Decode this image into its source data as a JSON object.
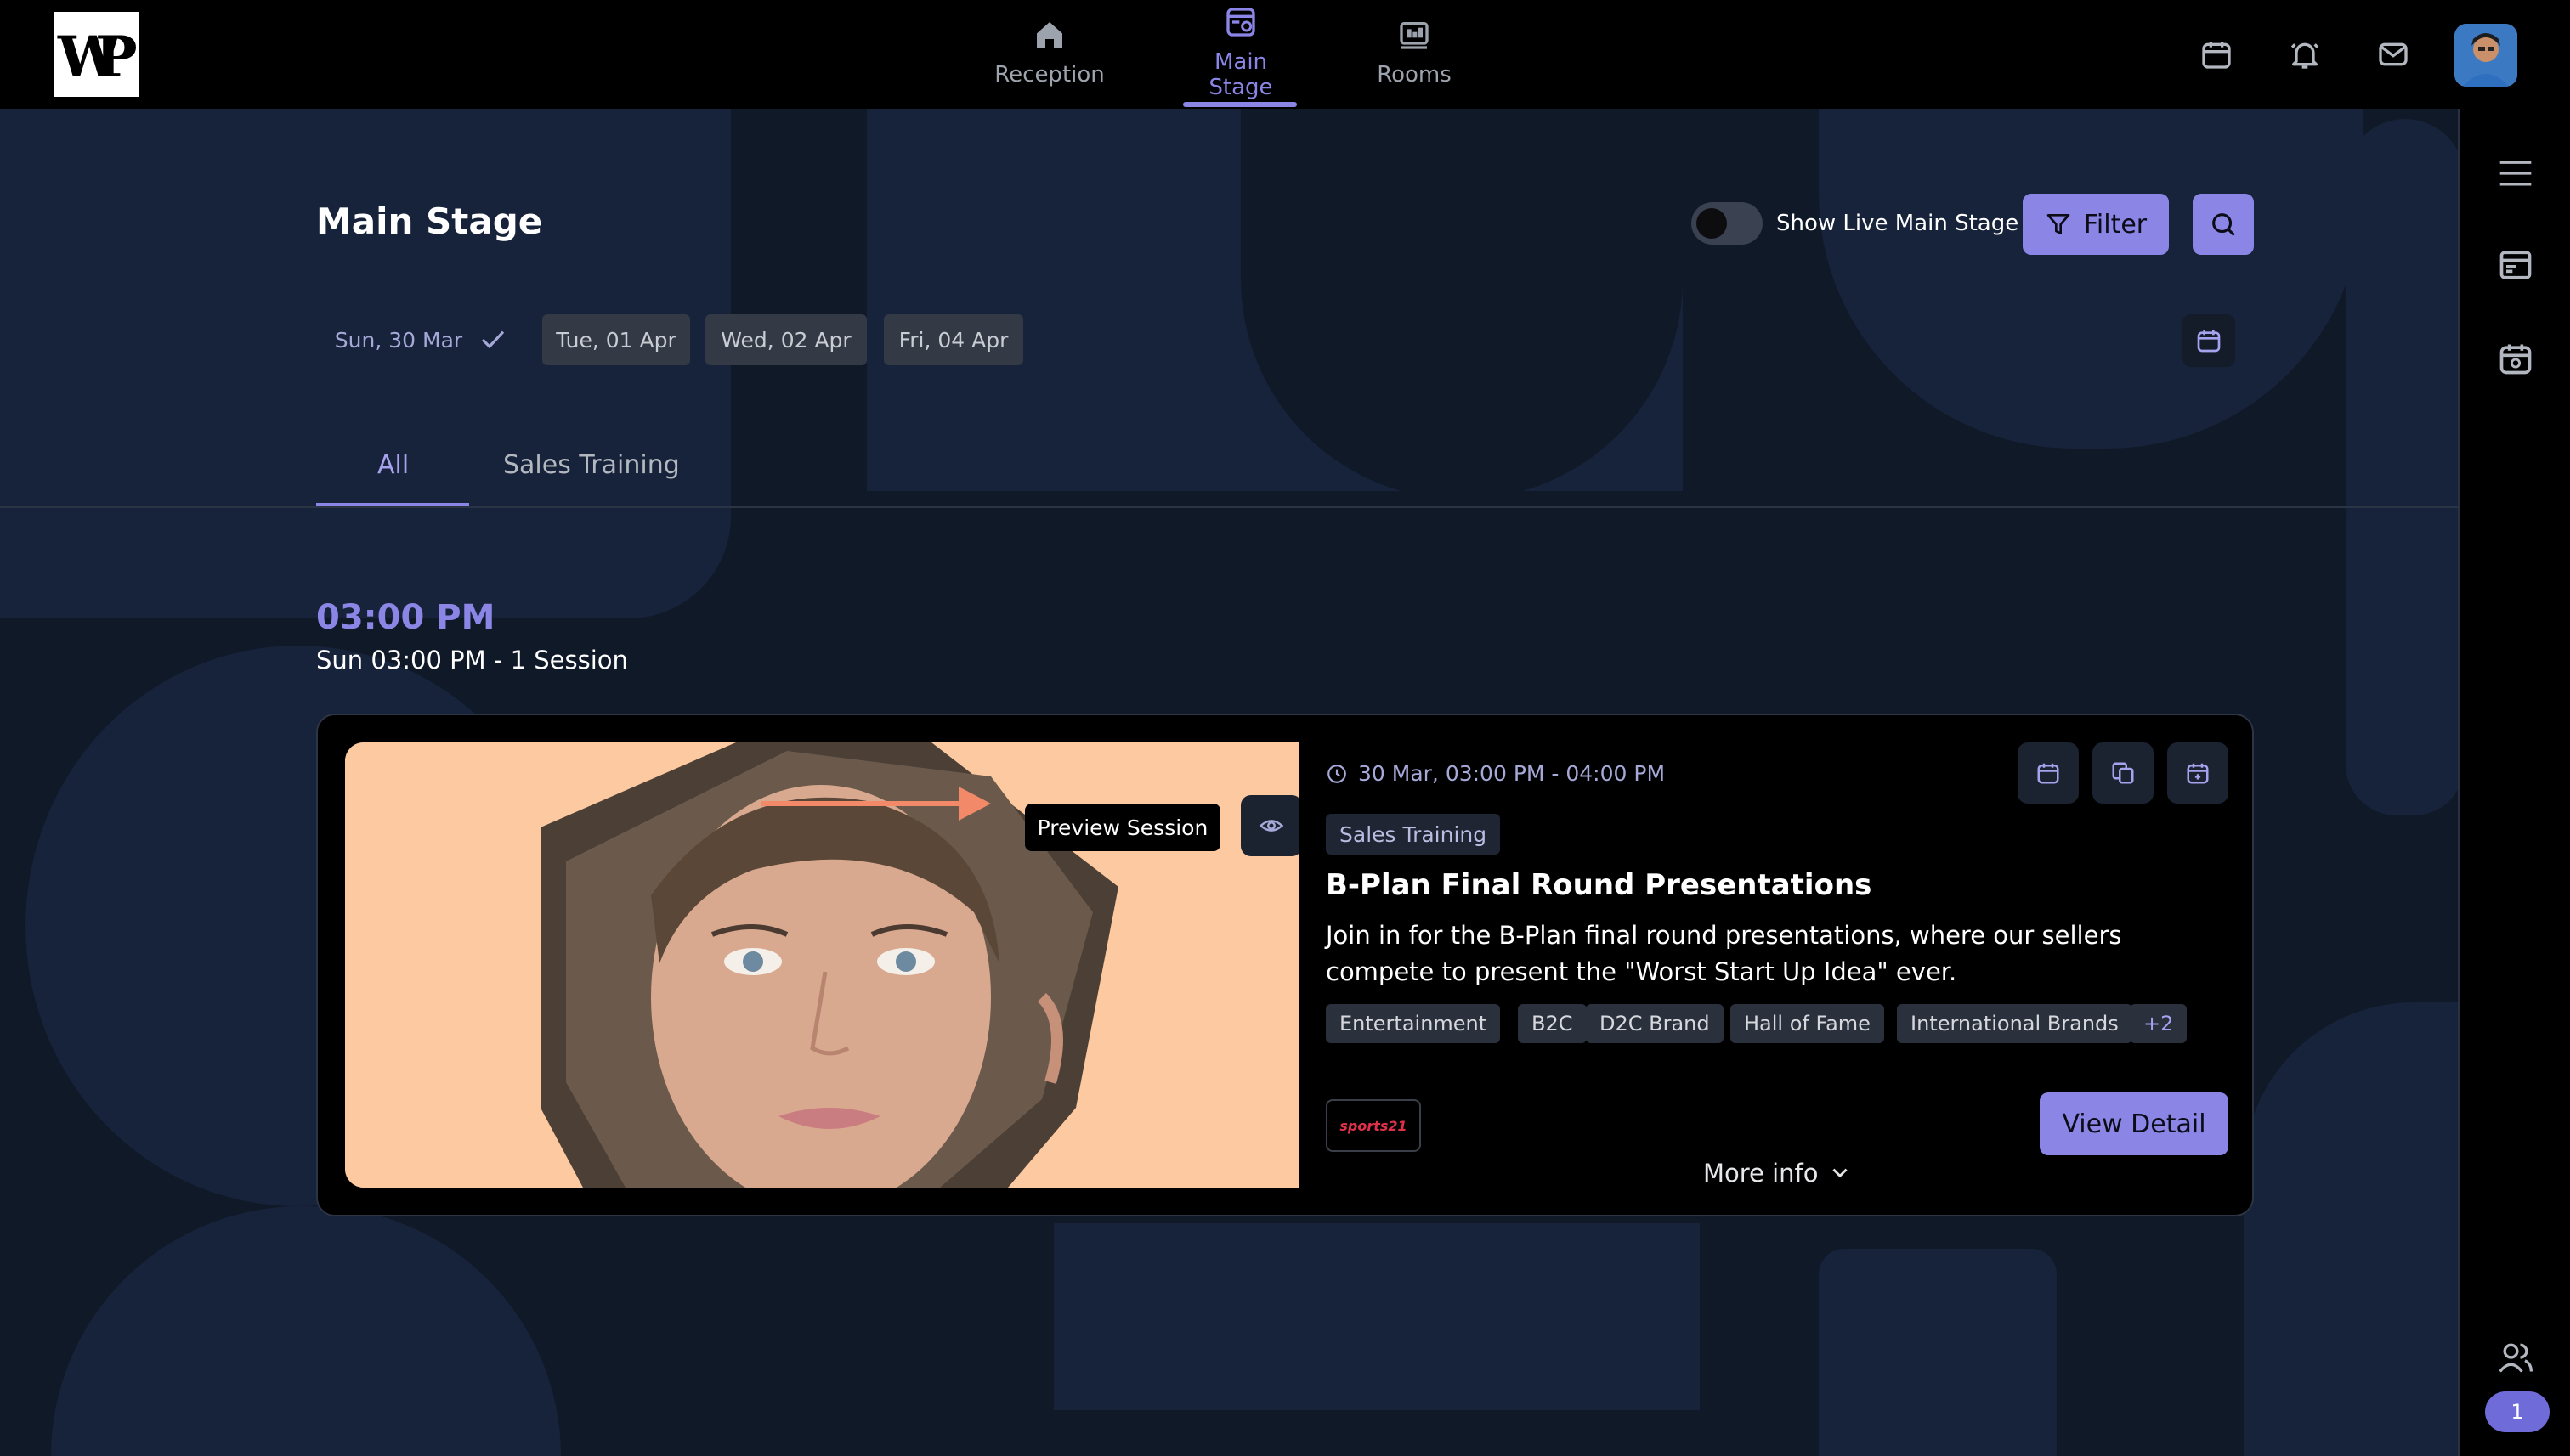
{
  "app": {
    "logo_text": "WP"
  },
  "nav": {
    "items": [
      {
        "label": "Reception",
        "icon": "home-icon"
      },
      {
        "label": "Main Stage",
        "icon": "stage-icon",
        "active": true
      },
      {
        "label": "Rooms",
        "icon": "rooms-icon"
      }
    ]
  },
  "topbar_icons": [
    "calendar-icon",
    "bell-icon",
    "mail-icon"
  ],
  "page": {
    "title": "Main Stage",
    "toggle_label": "Show Live Main Stage",
    "toggle_on": false,
    "filter_label": "Filter"
  },
  "dates": [
    {
      "label": "Sun, 30 Mar",
      "selected": true
    },
    {
      "label": "Tue, 01 Apr",
      "selected": false
    },
    {
      "label": "Wed, 02 Apr",
      "selected": false
    },
    {
      "label": "Fri, 04 Apr",
      "selected": false
    }
  ],
  "tabs": [
    {
      "label": "All",
      "active": true
    },
    {
      "label": "Sales Training",
      "active": false
    }
  ],
  "schedule": {
    "time": "03:00 PM",
    "subtitle": "Sun 03:00 PM - 1  Session"
  },
  "session": {
    "tooltip": "Preview Session",
    "datetime": "30 Mar, 03:00 PM - 04:00 PM",
    "track": "Sales Training",
    "title": "B-Plan Final Round Presentations",
    "description": "Join in for the B-Plan final round presentations, where our sellers compete to present the \"Worst Start Up Idea\" ever.",
    "tags": [
      "Entertainment",
      "B2C",
      "D2C Brand",
      "Hall of Fame",
      "International Brands",
      "+2"
    ],
    "sponsor": "sports21",
    "view_label": "View Detail",
    "more_info_label": "More info"
  },
  "sidebar": {
    "attendees_count": "1"
  },
  "colors": {
    "accent": "#8b86e6",
    "background": "#0f1928",
    "bar": "#000000",
    "thumb_bg": "#fdc9a0"
  }
}
